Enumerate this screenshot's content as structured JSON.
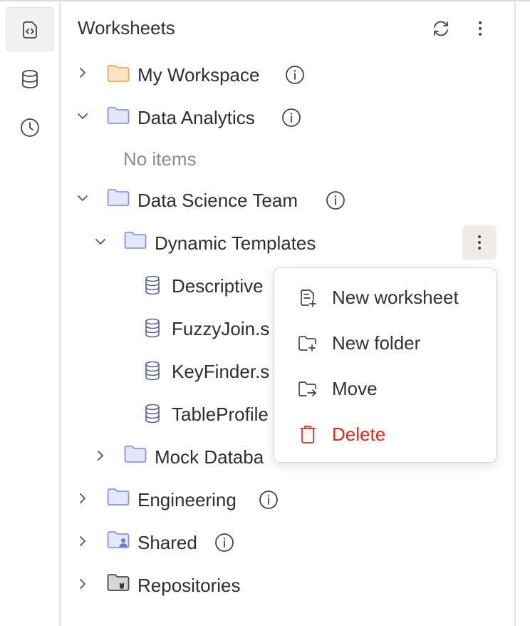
{
  "header": {
    "title": "Worksheets"
  },
  "rail": {
    "items": [
      {
        "icon": "worksheet-code-icon",
        "active": true
      },
      {
        "icon": "database-icon",
        "active": false
      },
      {
        "icon": "clock-icon",
        "active": false
      }
    ]
  },
  "tree": {
    "my_workspace": "My Workspace",
    "data_analytics": "Data Analytics",
    "no_items": "No items",
    "data_science_team": "Data Science Team",
    "dynamic_templates": "Dynamic Templates",
    "file_descriptive": "Descriptive",
    "file_fuzzyjoin": "FuzzyJoin.s",
    "file_keyfinder": "KeyFinder.s",
    "file_tableprofile": "TableProfile",
    "mock_database": "Mock Databa",
    "engineering": "Engineering",
    "shared": "Shared",
    "repositories": "Repositories"
  },
  "context_menu": {
    "new_worksheet": "New worksheet",
    "new_folder": "New folder",
    "move": "Move",
    "delete": "Delete"
  },
  "colors": {
    "folder_orange": "#f2a65a",
    "folder_orange_fill": "#fde3c8",
    "folder_blue": "#8a95e0",
    "folder_blue_fill": "#e3e7fb",
    "folder_dark": "#4a4a4a",
    "danger": "#d92d20",
    "db_blue": "#5a6290"
  }
}
